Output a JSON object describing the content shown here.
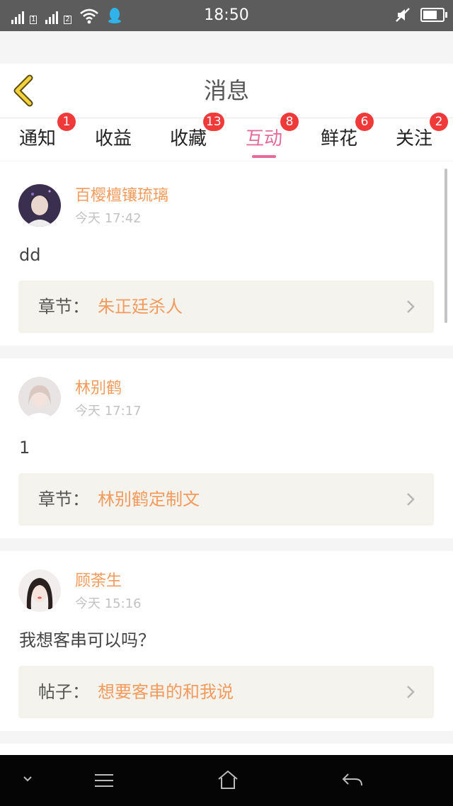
{
  "status_bar": {
    "time": "18:50",
    "sim1_label": "1",
    "sim2_label": "2",
    "icons": [
      "signal-icon",
      "signal-icon",
      "wifi-icon",
      "qq-icon",
      "mute-icon",
      "battery-icon"
    ],
    "battery_level": 0.85
  },
  "header": {
    "title": "消息",
    "back_icon": "chevron-left-icon",
    "accent_color": "#f3d23e"
  },
  "tabs": [
    {
      "label": "通知",
      "badge": "1"
    },
    {
      "label": "收益",
      "badge": ""
    },
    {
      "label": "收藏",
      "badge": "13"
    },
    {
      "label": "互动",
      "badge": "8",
      "active": true
    },
    {
      "label": "鲜花",
      "badge": "6"
    },
    {
      "label": "关注",
      "badge": "2"
    }
  ],
  "messages": [
    {
      "user": "百樱檀镶琉璃",
      "time": "今天 17:42",
      "content": "dd",
      "ref_prefix": "章节：",
      "ref_title": "朱正廷杀人"
    },
    {
      "user": "林别鹤",
      "time": "今天 17:17",
      "content": "1",
      "ref_prefix": "章节：",
      "ref_title": "林别鹤定制文"
    },
    {
      "user": "顾荼生",
      "time": "今天 15:16",
      "content": "我想客串可以吗？",
      "ref_prefix": "帖子：",
      "ref_title": "想要客串的和我说"
    }
  ],
  "colors": {
    "active_tab": "#e46b9a",
    "username": "#f39a5c",
    "badge": "#f03a3a",
    "ref_background": "#f4f3ed"
  },
  "nav_bar": {
    "icons": [
      "chevron-down-icon",
      "menu-icon",
      "home-icon",
      "back-arrow-icon"
    ]
  }
}
